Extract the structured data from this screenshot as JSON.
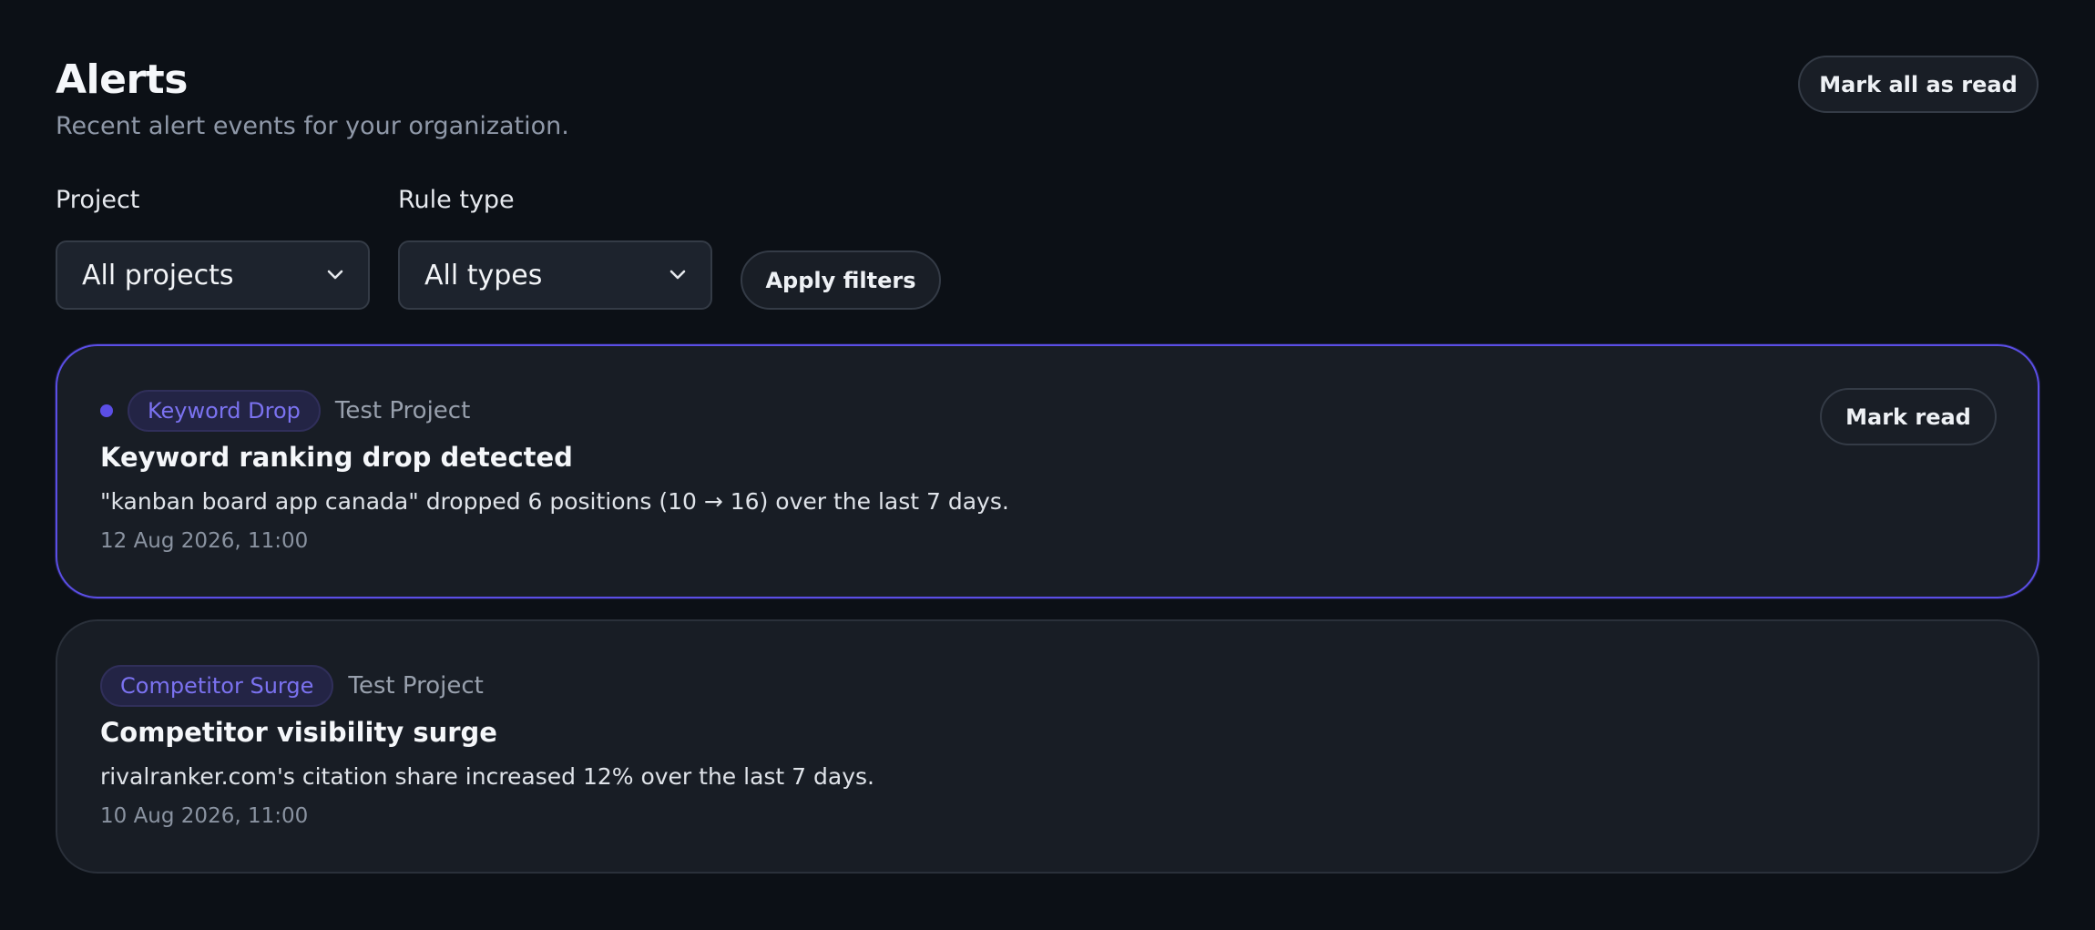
{
  "header": {
    "title": "Alerts",
    "subtitle": "Recent alert events for your organization.",
    "mark_all_label": "Mark all as read"
  },
  "filters": {
    "project_label": "Project",
    "project_value": "All projects",
    "rule_type_label": "Rule type",
    "rule_type_value": "All types",
    "apply_label": "Apply filters"
  },
  "alerts": [
    {
      "unread": true,
      "tag": "Keyword Drop",
      "project": "Test Project",
      "title": "Keyword ranking drop detected",
      "description": "\"kanban board app canada\" dropped 6 positions (10 → 16) over the last 7 days.",
      "timestamp": "12 Aug 2026, 11:00",
      "action_label": "Mark read"
    },
    {
      "unread": false,
      "tag": "Competitor Surge",
      "project": "Test Project",
      "title": "Competitor visibility surge",
      "description": "rivalranker.com's citation share increased 12% over the last 7 days.",
      "timestamp": "10 Aug 2026, 11:00"
    }
  ],
  "icons": {
    "select_chevron": "chevron-down-icon",
    "unread_marker": "unread-dot-icon"
  },
  "colors": {
    "background": "#0c1016",
    "card": "#181d25",
    "accent": "#5b4ee6",
    "tag_text": "#7b72f0",
    "muted_text": "#8f98a8"
  }
}
